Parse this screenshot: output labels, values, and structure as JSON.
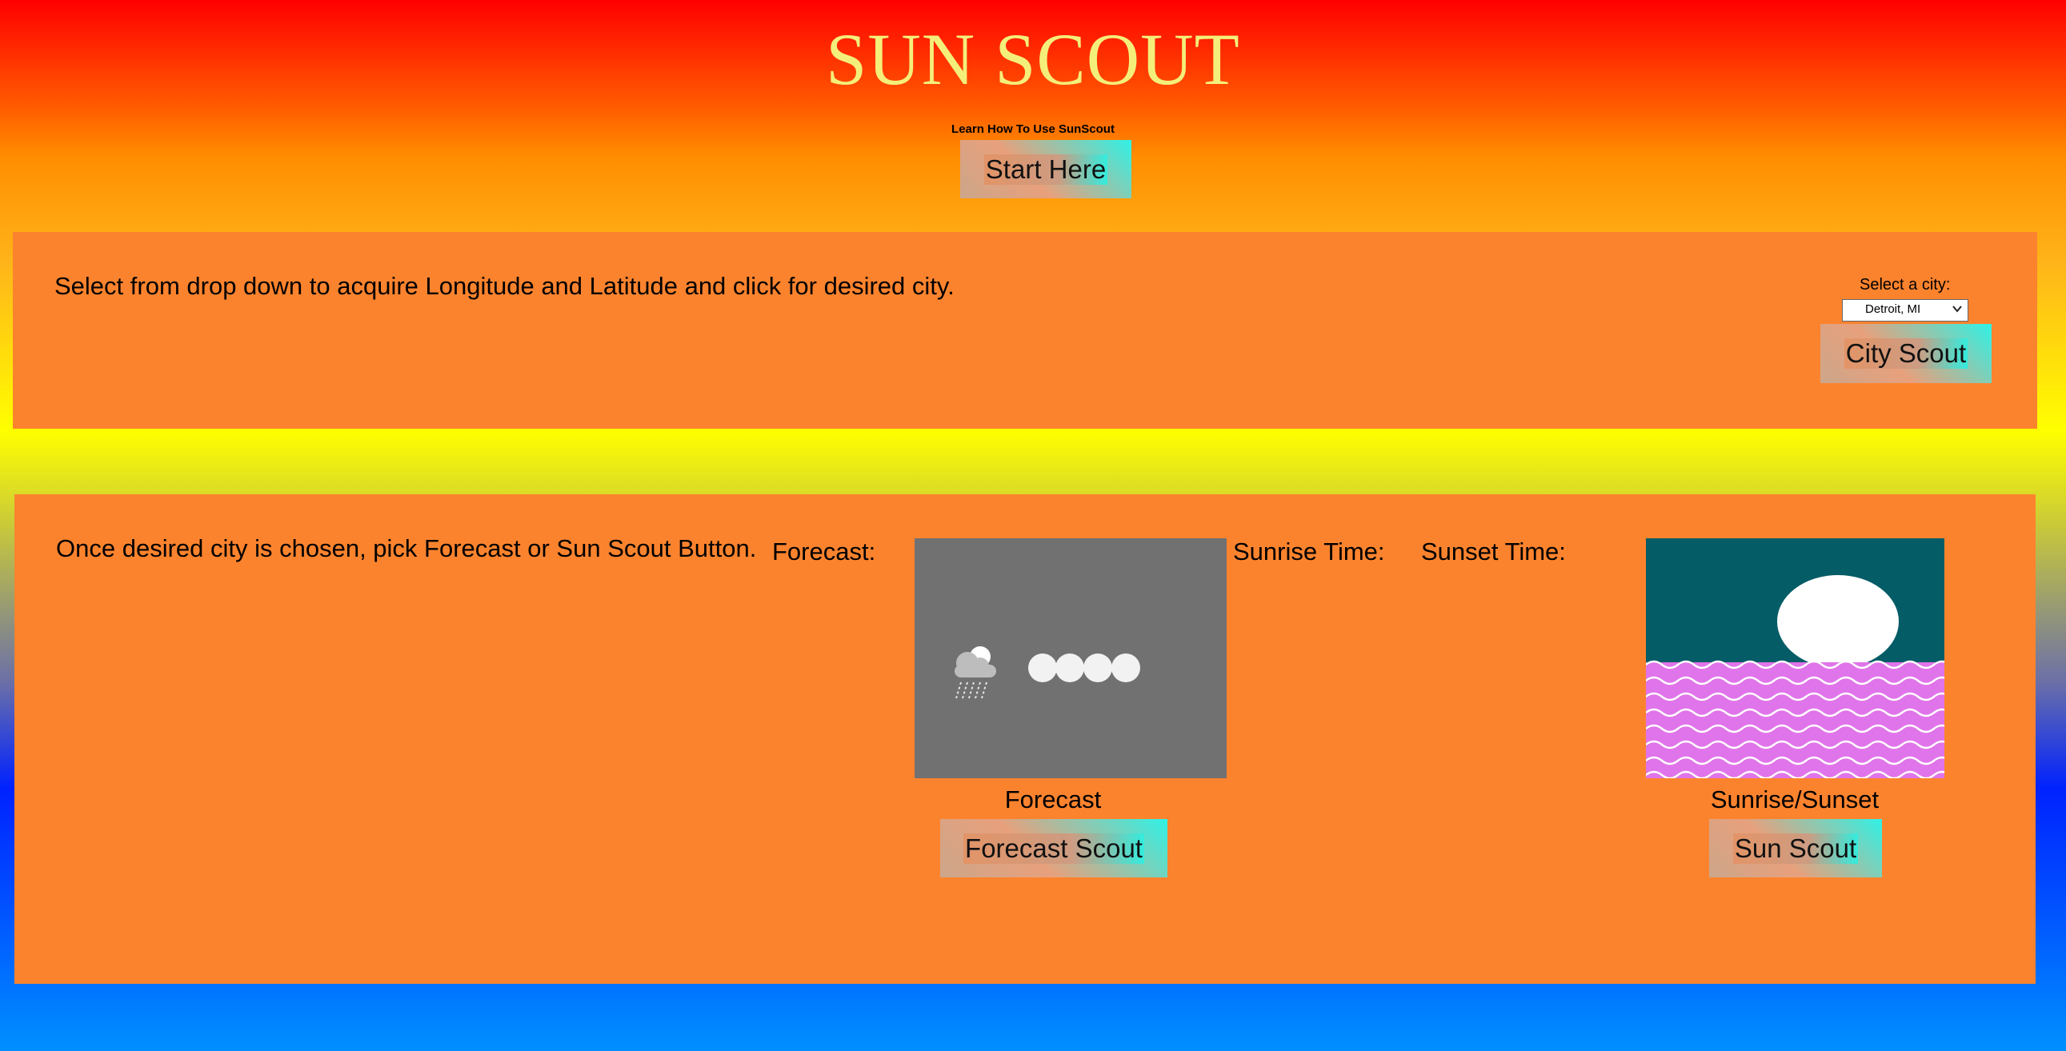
{
  "header": {
    "title": "SUN SCOUT",
    "learn_label": "Learn How To Use SunScout",
    "start_button": "Start Here"
  },
  "city_panel": {
    "instructions": "Select from drop down to acquire Longitude and Latitude and click for desired city.",
    "select_label": "Select a city:",
    "selected_city": "Detroit, MI",
    "city_button": "City Scout"
  },
  "scout_panel": {
    "instructions": "Once desired city is chosen, pick Forecast or Sun Scout Button.",
    "forecast_label": "Forecast:",
    "sunrise_label": "Sunrise Time:",
    "sunset_label": "Sunset Time:",
    "forecast_caption": "Forecast",
    "forecast_button": "Forecast Scout",
    "sun_caption": "Sunrise/Sunset",
    "sun_button": "Sun Scout"
  },
  "icons": {
    "forecast_weather": "rain-cloud-icon",
    "forecast_loading": "loading-dots-icon",
    "sun_scene": "sunset-over-water-icon",
    "select_chevron": "chevron-down-icon"
  },
  "colors": {
    "panel": "#fc832e",
    "title": "#f4ef7a",
    "button_accent": "#2ff2e6",
    "forecast_image_bg": "#717171",
    "sun_image_sky": "#045c66",
    "sun_image_water": "#e074ea"
  }
}
